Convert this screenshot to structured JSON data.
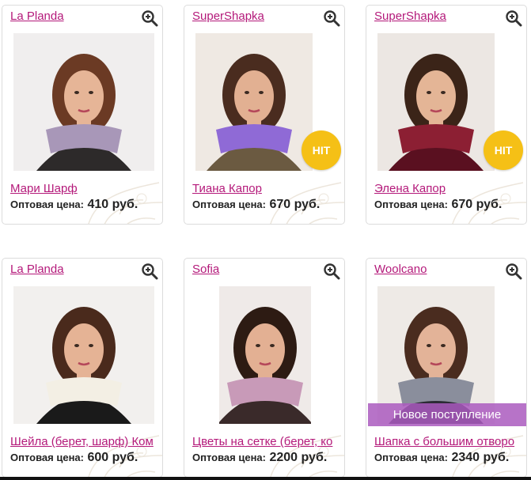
{
  "products": [
    {
      "brand": "La Planda",
      "title": "Мари Шарф",
      "price_label": "Оптовая цена:",
      "price": "410 руб.",
      "badge": "",
      "palette": {
        "bg": "#f0eeee",
        "hair": "#6b3a24",
        "skin": "#e6b597",
        "garment": "#a897b8",
        "body": "#2d2a2a"
      }
    },
    {
      "brand": "SuperShapka",
      "title": "Тиана Капор",
      "price_label": "Оптовая цена:",
      "price": "670 руб.",
      "badge": "HIT",
      "palette": {
        "bg": "#efe9e3",
        "hair": "#4a2c1f",
        "skin": "#e2b092",
        "garment": "#8f6ad6",
        "body": "#6b5a41"
      }
    },
    {
      "brand": "SuperShapka",
      "title": "Элена Капор",
      "price_label": "Оптовая цена:",
      "price": "670 руб.",
      "badge": "HIT",
      "palette": {
        "bg": "#ece7e3",
        "hair": "#3b2418",
        "skin": "#e4b596",
        "garment": "#8c1f33",
        "body": "#5a1020"
      }
    },
    {
      "brand": "La Planda",
      "title": "Шейла (берет, шарф) Ком",
      "price_label": "Оптовая цена:",
      "price": "600 руб.",
      "badge": "",
      "palette": {
        "bg": "#f2f0ee",
        "hair": "#4a2a1c",
        "skin": "#e5b395",
        "garment": "#f3efe4",
        "body": "#1a1a1a"
      }
    },
    {
      "brand": "Sofia",
      "title": "Цветы на сетке (берет, ко",
      "price_label": "Оптовая цена:",
      "price": "2200 руб.",
      "badge": "",
      "palette": {
        "bg": "#efeae8",
        "hair": "#2d1b13",
        "skin": "#e3b093",
        "garment": "#c89ab8",
        "body": "#3a2a2a"
      }
    },
    {
      "brand": "Woolcano",
      "title": "Шапка с большим отворо",
      "price_label": "Оптовая цена:",
      "price": "2340 руб.",
      "badge": "Новое поступление",
      "palette": {
        "bg": "#eeeae6",
        "hair": "#4a2c1f",
        "skin": "#e3b398",
        "garment": "#8a8e9c",
        "body": "#2b2b35"
      }
    }
  ]
}
